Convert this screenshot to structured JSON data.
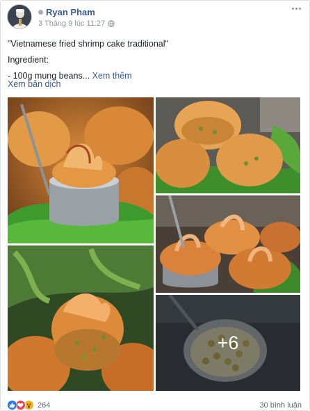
{
  "post": {
    "author_name": "Ryan Pham",
    "timestamp": "3 Tháng 9 lúc 11:27",
    "privacy_icon": "globe-icon",
    "body_lines": [
      "\"Vietnamese fried shrimp cake traditional\"",
      "Ingredient:",
      "- 100g mung beans..."
    ],
    "see_more": "Xem thêm",
    "translate": "Xem bản dịch",
    "more_photos": "+6",
    "reaction_icons": [
      "like-icon",
      "love-icon",
      "wow-icon"
    ],
    "reaction_count": "264",
    "comment_count": "30 bình luận"
  },
  "colors": {
    "link": "#365899",
    "muted": "#90949c",
    "like": "#2078f4",
    "love": "#f33e58",
    "wow": "#f7b125"
  }
}
